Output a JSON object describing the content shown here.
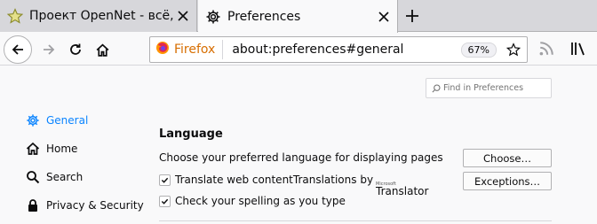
{
  "tabs": [
    {
      "title": "Проект OpenNet - всё, ч",
      "icon": "star-icon"
    },
    {
      "title": "Preferences",
      "icon": "gear-icon"
    }
  ],
  "navbar": {
    "identity_label": "Firefox",
    "url": "about:preferences#general",
    "zoom": "67%"
  },
  "search": {
    "placeholder": "Find in Preferences"
  },
  "sidebar": {
    "items": [
      {
        "label": "General",
        "icon": "gear-icon",
        "active": true
      },
      {
        "label": "Home",
        "icon": "home-icon"
      },
      {
        "label": "Search",
        "icon": "search-icon"
      },
      {
        "label": "Privacy & Security",
        "icon": "lock-icon"
      }
    ]
  },
  "language": {
    "heading": "Language",
    "choose_text": "Choose your preferred language for displaying pages",
    "choose_button": "Choose…",
    "translate_text": "Translate web contentTranslations by",
    "translator_ms": "Microsoft",
    "translator_name": "Translator",
    "translate_checked": true,
    "exceptions_button": "Exceptions…",
    "spelling_text": "Check your spelling as you type",
    "spelling_checked": true
  },
  "colors": {
    "accent": "#0a84ff",
    "firefox_orange": "#d76e00"
  }
}
